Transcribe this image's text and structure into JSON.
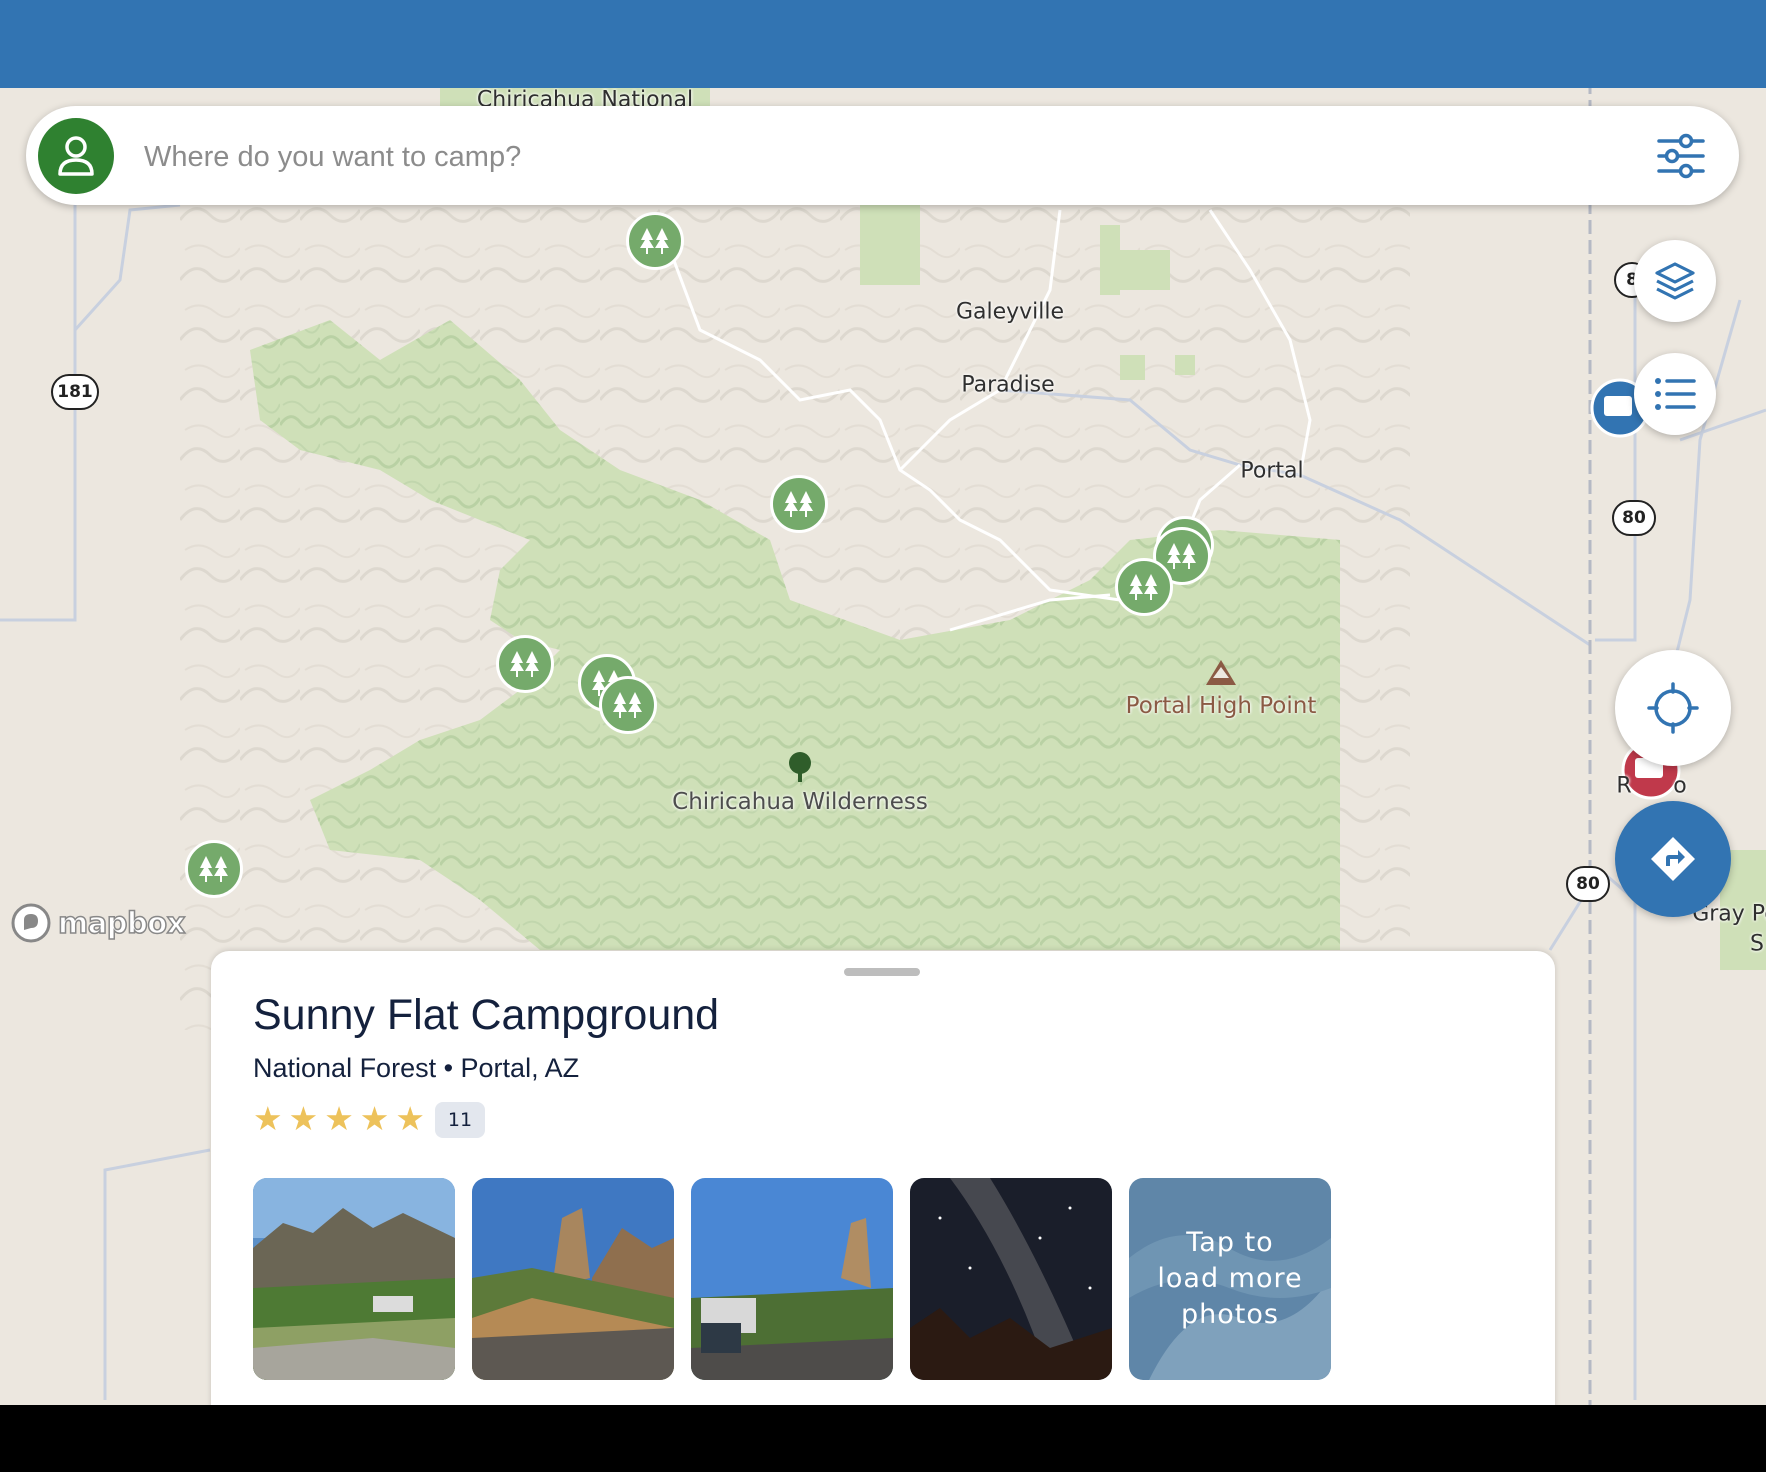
{
  "search": {
    "placeholder": "Where do you want to camp?"
  },
  "map": {
    "labels": {
      "galeyville": "Galeyville",
      "paradise": "Paradise",
      "portal": "Portal",
      "portal_high_point": "Portal High Point",
      "wilderness": "Chiricahua Wilderness",
      "chiricahua_national_partial": "Chiricahua National",
      "gray_peak_partial": "Gray Pe",
      "gray_peak_partial2": "S",
      "rodeo_partial": "R",
      "rodeo_partial2": "o"
    },
    "routes": {
      "r181": "181",
      "r80a": "80",
      "r80b": "80",
      "r8_partial": "8"
    },
    "attribution": "mapbox"
  },
  "colors": {
    "status_bar": "#3274b2",
    "accent": "#2f8130",
    "pin_green": "#75aa6b",
    "brand_blue": "#3274b2",
    "star": "#edc25b"
  },
  "icons": {
    "profile": "person-icon",
    "filter": "sliders-icon",
    "layers": "layers-icon",
    "list": "list-icon",
    "locate": "crosshair-icon",
    "directions": "directions-icon",
    "pin": "trees-icon"
  },
  "campground": {
    "name": "Sunny Flat Campground",
    "subtitle": "National Forest • Portal, AZ",
    "rating": 5,
    "review_count": "11",
    "more_photos_label": "Tap to\nload more\nphotos"
  }
}
